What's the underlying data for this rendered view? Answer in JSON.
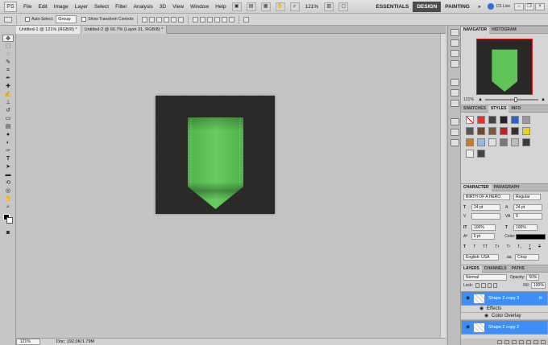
{
  "menubar": {
    "logo": "PS",
    "items": [
      "File",
      "Edit",
      "Image",
      "Layer",
      "Select",
      "Filter",
      "Analysis",
      "3D",
      "View",
      "Window",
      "Help"
    ],
    "zoom": "121%",
    "workspaces": [
      "ESSENTIALS",
      "DESIGN",
      "PAINTING"
    ],
    "more": "»",
    "cslive": "CS Live"
  },
  "options": {
    "auto_select_label": "Auto-Select:",
    "auto_select_value": "Group",
    "transform_label": "Show Transform Controls"
  },
  "tabs": [
    {
      "label": "Untitled-1 @ 121% (RGB/8) *",
      "active": true
    },
    {
      "label": "Untitled-2 @ 66.7% (Layer 31, RGB/8) *",
      "active": false
    }
  ],
  "status": {
    "zoom": "121%",
    "doc": "Doc: 192.0K/1.79M"
  },
  "navigator": {
    "tabs": [
      "NAVIGATOR",
      "HISTOGRAM"
    ],
    "zoom": "121%"
  },
  "swatches": {
    "tabs": [
      "SWATCHES",
      "STYLES",
      "INFO"
    ]
  },
  "character": {
    "tabs": [
      "CHARACTER",
      "PARAGRAPH"
    ],
    "font": "BIRTH OF A HERO",
    "style": "Regular",
    "size": "24 pt",
    "leading": "24 pt",
    "tracking": "0",
    "vscale": "100%",
    "hscale": "100%",
    "baseline": "0 pt",
    "color_label": "Color:",
    "language": "English: USA",
    "aa_label": "aa",
    "aa_value": "Crisp"
  },
  "layers": {
    "tabs": [
      "LAYERS",
      "CHANNELS",
      "PATHS"
    ],
    "blend": "Normal",
    "opacity_label": "Opacity:",
    "opacity": "50%",
    "lock_label": "Lock:",
    "fill_label": "Fill:",
    "fill": "100%",
    "rows": [
      {
        "name": "Shape 2 copy 3",
        "fx": "fx",
        "selected": true
      },
      {
        "name": "Effects",
        "sub": true
      },
      {
        "name": "Color Overlay",
        "sub": true
      },
      {
        "name": "Shape 2 copy 2",
        "selected": true
      }
    ]
  },
  "colors": {
    "ribbon": "#5ec457",
    "ribbon_dark": "#3f9c3a",
    "bg": "#2b2828",
    "accent": "#3d8ff7"
  }
}
